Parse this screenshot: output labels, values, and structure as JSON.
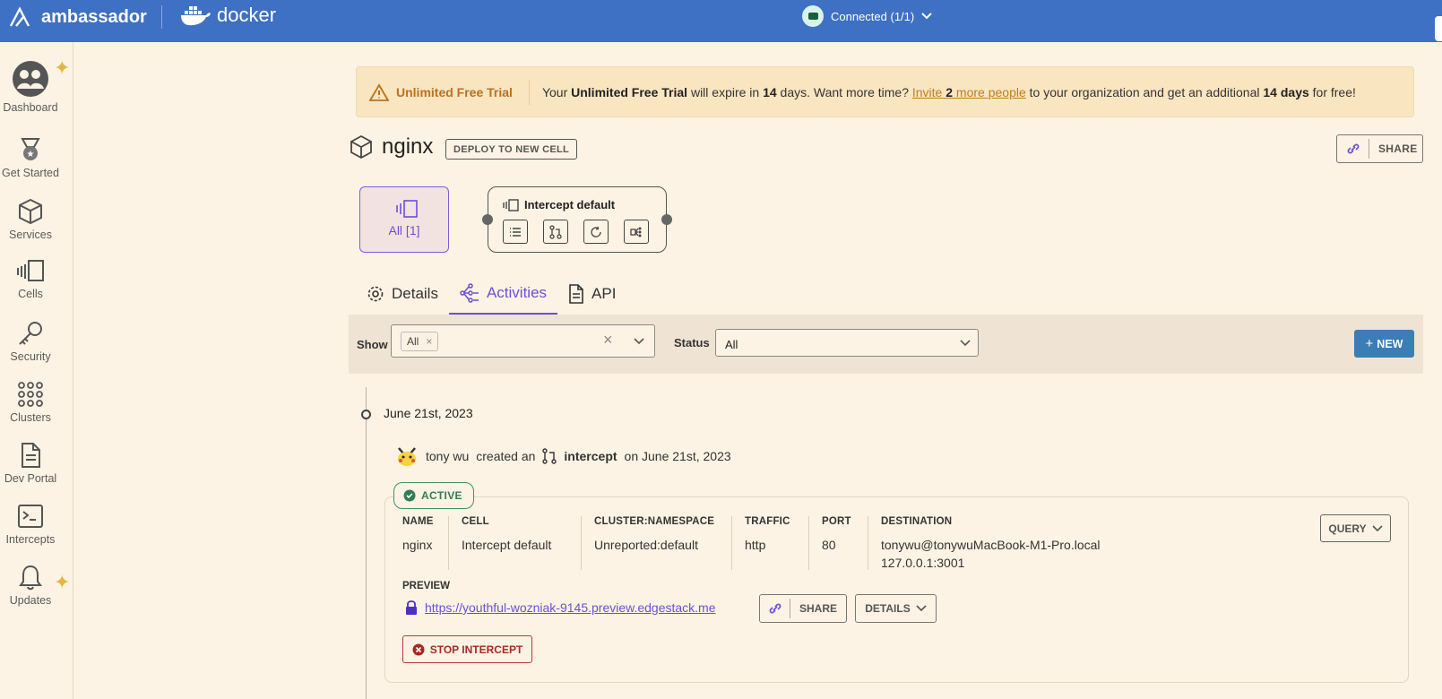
{
  "topbar": {
    "brand": "ambassador",
    "docker": "docker",
    "connection": "Connected (1/1)"
  },
  "sidebar": {
    "items": [
      {
        "label": "Dashboard"
      },
      {
        "label": "Get Started"
      },
      {
        "label": "Services"
      },
      {
        "label": "Cells"
      },
      {
        "label": "Security"
      },
      {
        "label": "Clusters"
      },
      {
        "label": "Dev Portal"
      },
      {
        "label": "Intercepts"
      },
      {
        "label": "Updates"
      }
    ]
  },
  "trial": {
    "title": "Unlimited Free Trial",
    "msg_1": "Your ",
    "msg_bold_1": "Unlimited Free Trial",
    "msg_2": " will expire in ",
    "msg_days": "14",
    "msg_3": " days. Want more time? ",
    "link_1": "Invite ",
    "link_bold": "2",
    "link_2": " more people",
    "msg_4": " to your organization and get an additional ",
    "msg_bold_2": "14 days",
    "msg_5": " for free!"
  },
  "service": {
    "name": "nginx",
    "deploy_label": "DEPLOY TO NEW CELL",
    "share_label": "SHARE"
  },
  "cells": {
    "all_label": "All [1]",
    "intercept_title": "Intercept default"
  },
  "tabs": [
    {
      "label": "Details"
    },
    {
      "label": "Activities"
    },
    {
      "label": "API"
    }
  ],
  "filters": {
    "show_label": "Show",
    "show_chip": "All",
    "status_label": "Status",
    "status_value": "All",
    "new_label": "NEW"
  },
  "timeline": {
    "date": "June 21st, 2023",
    "user": "tony wu",
    "action": "created an",
    "object": "intercept",
    "on": "on June 21st, 2023"
  },
  "intercept": {
    "status": "ACTIVE",
    "columns": [
      {
        "header": "NAME",
        "value": "nginx"
      },
      {
        "header": "CELL",
        "value": "Intercept default"
      },
      {
        "header": "CLUSTER:NAMESPACE",
        "value": "Unreported:default"
      },
      {
        "header": "TRAFFIC",
        "value": "http"
      },
      {
        "header": "PORT",
        "value": "80"
      },
      {
        "header": "DESTINATION",
        "value": "tonywu@tonywuMacBook-M1-Pro.local",
        "value2": "127.0.0.1:3001"
      }
    ],
    "query_label": "QUERY",
    "preview_header": "PREVIEW",
    "preview_url": "https://youthful-wozniak-9145.preview.edgestack.me",
    "share_label": "SHARE",
    "details_label": "DETAILS",
    "stop_label": "STOP INTERCEPT"
  },
  "colors": {
    "topbar": "#3e70c3",
    "accent": "#6c4fd6",
    "success": "#2e7d58",
    "danger": "#a52a25",
    "trial_bg": "#fae5c1"
  }
}
